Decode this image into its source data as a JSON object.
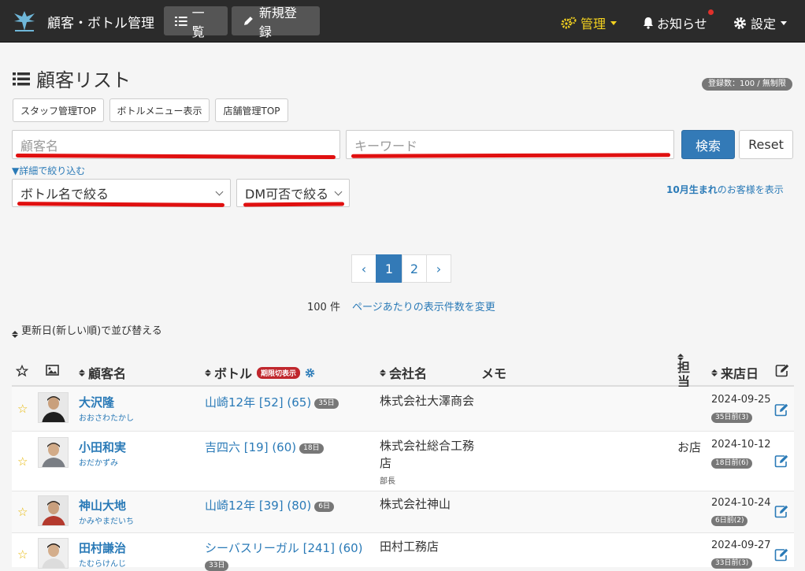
{
  "nav": {
    "title": "顧客・ボトル管理",
    "list_label": "一覧",
    "new_label": "新規登録",
    "admin_label": "管理",
    "notice_label": "お知らせ",
    "settings_label": "設定"
  },
  "page": {
    "title": "顧客リスト",
    "registration_badge": "登録数：100 / 無制限",
    "buttons": [
      "スタッフ管理TOP",
      "ボトルメニュー表示",
      "店舗管理TOP"
    ]
  },
  "search": {
    "name_placeholder": "顧客名",
    "keyword_placeholder": "キーワード",
    "search_label": "検索",
    "reset_label": "Reset",
    "filter_toggle": "▼詳細で絞り込む",
    "bottle_select": "ボトル名で絞る",
    "dm_select": "DM可否で絞る",
    "birthday_prefix": "10月生まれ",
    "birthday_suffix": "のお客様を表示"
  },
  "pagination": {
    "prev": "‹",
    "pages": [
      "1",
      "2"
    ],
    "next": "›",
    "count": "100 件",
    "perpage_link": "ページあたりの表示件数を変更"
  },
  "sort_label": "更新日(新しい順)で並び替える",
  "table": {
    "headers": {
      "name": "顧客名",
      "bottle": "ボトル",
      "expiry_badge": "期限切表示",
      "company": "会社名",
      "memo": "メモ",
      "staff": "担当",
      "visit": "来店日"
    },
    "rows": [
      {
        "name": "大沢隆",
        "kana": "おおさわたかし",
        "bottle": "山崎12年 [52] (65)",
        "bottle_days": "35日",
        "company": "株式会社大澤商会",
        "position": "",
        "staff": "",
        "visit_date": "2024-09-25",
        "visit_badge": "35日前(3)"
      },
      {
        "name": "小田和実",
        "kana": "おだかずみ",
        "bottle": "吉四六 [19] (60)",
        "bottle_days": "18日",
        "company": "株式会社総合工務店",
        "position": "部長",
        "staff": "お店",
        "visit_date": "2024-10-12",
        "visit_badge": "18日前(6)"
      },
      {
        "name": "神山大地",
        "kana": "かみやまだいち",
        "bottle": "山崎12年 [39] (80)",
        "bottle_days": "6日",
        "company": "株式会社神山",
        "position": "",
        "staff": "",
        "visit_date": "2024-10-24",
        "visit_badge": "6日前(2)"
      },
      {
        "name": "田村謙治",
        "kana": "たむらけんじ",
        "bottle": "シーバスリーガル [241] (60)",
        "bottle_days": "33日",
        "company": "田村工務店",
        "position": "",
        "staff": "",
        "visit_date": "2024-09-27",
        "visit_badge": "33日前(3)"
      }
    ]
  },
  "colors": {
    "accent": "#337ab7",
    "admin": "#f4d21f",
    "link": "#2a7ab7",
    "annotation": "#e01010"
  }
}
